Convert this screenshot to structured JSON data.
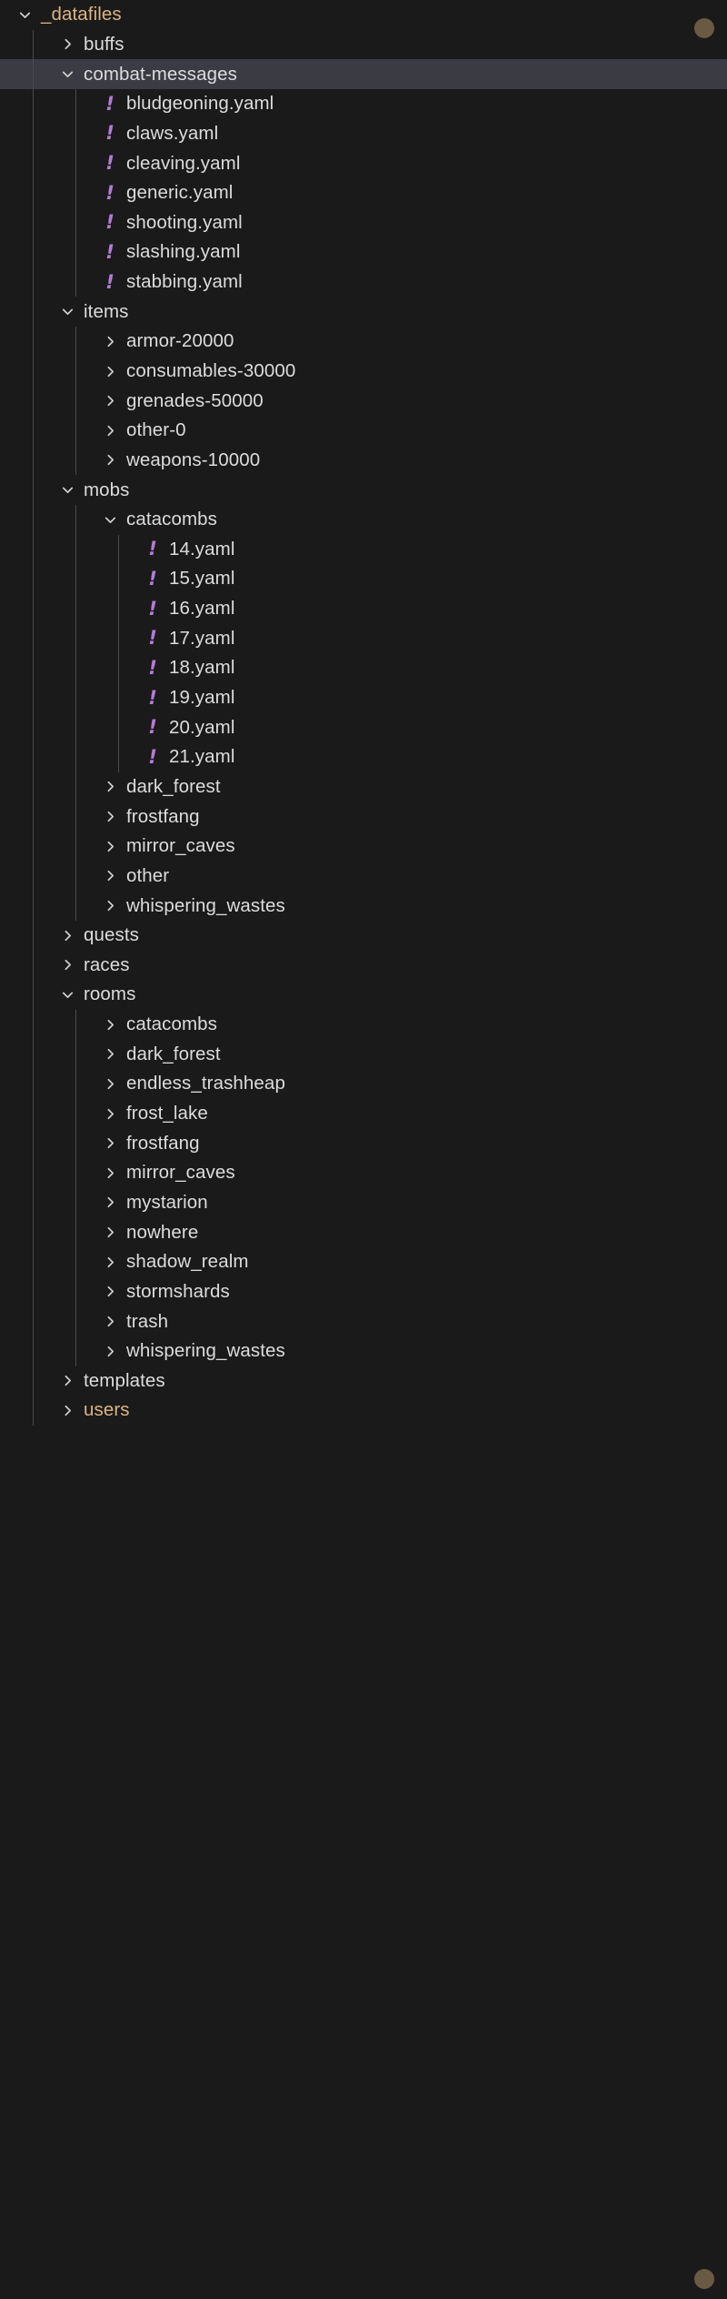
{
  "theme": {
    "background": "#1a1a1a",
    "selected_row_background": "#3b3b44",
    "text_color": "#dcdcdc",
    "accent_color": "#dbb382",
    "yaml_icon_color": "#b57bd8",
    "guide_color": "#4a4a4a",
    "dot_color": "#6b5a43"
  },
  "icons": {
    "chevron_right": "chevron-right-icon",
    "chevron_down": "chevron-down-icon",
    "yaml_file": "yaml-file-icon",
    "status_dot": "status-dot-icon"
  },
  "tree": {
    "root_label": "_datafiles",
    "nodes": [
      {
        "label": "_datafiles",
        "depth": 0,
        "type": "folder",
        "state": "expanded",
        "accent": true,
        "selected": false
      },
      {
        "label": "buffs",
        "depth": 1,
        "type": "folder",
        "state": "collapsed",
        "accent": false,
        "selected": false
      },
      {
        "label": "combat-messages",
        "depth": 1,
        "type": "folder",
        "state": "expanded",
        "accent": false,
        "selected": true
      },
      {
        "label": "bludgeoning.yaml",
        "depth": 2,
        "type": "file",
        "state": "none",
        "accent": false,
        "selected": false
      },
      {
        "label": "claws.yaml",
        "depth": 2,
        "type": "file",
        "state": "none",
        "accent": false,
        "selected": false
      },
      {
        "label": "cleaving.yaml",
        "depth": 2,
        "type": "file",
        "state": "none",
        "accent": false,
        "selected": false
      },
      {
        "label": "generic.yaml",
        "depth": 2,
        "type": "file",
        "state": "none",
        "accent": false,
        "selected": false
      },
      {
        "label": "shooting.yaml",
        "depth": 2,
        "type": "file",
        "state": "none",
        "accent": false,
        "selected": false
      },
      {
        "label": "slashing.yaml",
        "depth": 2,
        "type": "file",
        "state": "none",
        "accent": false,
        "selected": false
      },
      {
        "label": "stabbing.yaml",
        "depth": 2,
        "type": "file",
        "state": "none",
        "accent": false,
        "selected": false
      },
      {
        "label": "items",
        "depth": 1,
        "type": "folder",
        "state": "expanded",
        "accent": false,
        "selected": false
      },
      {
        "label": "armor-20000",
        "depth": 2,
        "type": "folder",
        "state": "collapsed",
        "accent": false,
        "selected": false
      },
      {
        "label": "consumables-30000",
        "depth": 2,
        "type": "folder",
        "state": "collapsed",
        "accent": false,
        "selected": false
      },
      {
        "label": "grenades-50000",
        "depth": 2,
        "type": "folder",
        "state": "collapsed",
        "accent": false,
        "selected": false
      },
      {
        "label": "other-0",
        "depth": 2,
        "type": "folder",
        "state": "collapsed",
        "accent": false,
        "selected": false
      },
      {
        "label": "weapons-10000",
        "depth": 2,
        "type": "folder",
        "state": "collapsed",
        "accent": false,
        "selected": false
      },
      {
        "label": "mobs",
        "depth": 1,
        "type": "folder",
        "state": "expanded",
        "accent": false,
        "selected": false
      },
      {
        "label": "catacombs",
        "depth": 2,
        "type": "folder",
        "state": "expanded",
        "accent": false,
        "selected": false
      },
      {
        "label": "14.yaml",
        "depth": 3,
        "type": "file",
        "state": "none",
        "accent": false,
        "selected": false
      },
      {
        "label": "15.yaml",
        "depth": 3,
        "type": "file",
        "state": "none",
        "accent": false,
        "selected": false
      },
      {
        "label": "16.yaml",
        "depth": 3,
        "type": "file",
        "state": "none",
        "accent": false,
        "selected": false
      },
      {
        "label": "17.yaml",
        "depth": 3,
        "type": "file",
        "state": "none",
        "accent": false,
        "selected": false
      },
      {
        "label": "18.yaml",
        "depth": 3,
        "type": "file",
        "state": "none",
        "accent": false,
        "selected": false
      },
      {
        "label": "19.yaml",
        "depth": 3,
        "type": "file",
        "state": "none",
        "accent": false,
        "selected": false
      },
      {
        "label": "20.yaml",
        "depth": 3,
        "type": "file",
        "state": "none",
        "accent": false,
        "selected": false
      },
      {
        "label": "21.yaml",
        "depth": 3,
        "type": "file",
        "state": "none",
        "accent": false,
        "selected": false
      },
      {
        "label": "dark_forest",
        "depth": 2,
        "type": "folder",
        "state": "collapsed",
        "accent": false,
        "selected": false
      },
      {
        "label": "frostfang",
        "depth": 2,
        "type": "folder",
        "state": "collapsed",
        "accent": false,
        "selected": false
      },
      {
        "label": "mirror_caves",
        "depth": 2,
        "type": "folder",
        "state": "collapsed",
        "accent": false,
        "selected": false
      },
      {
        "label": "other",
        "depth": 2,
        "type": "folder",
        "state": "collapsed",
        "accent": false,
        "selected": false
      },
      {
        "label": "whispering_wastes",
        "depth": 2,
        "type": "folder",
        "state": "collapsed",
        "accent": false,
        "selected": false
      },
      {
        "label": "quests",
        "depth": 1,
        "type": "folder",
        "state": "collapsed",
        "accent": false,
        "selected": false
      },
      {
        "label": "races",
        "depth": 1,
        "type": "folder",
        "state": "collapsed",
        "accent": false,
        "selected": false
      },
      {
        "label": "rooms",
        "depth": 1,
        "type": "folder",
        "state": "expanded",
        "accent": false,
        "selected": false
      },
      {
        "label": "catacombs",
        "depth": 2,
        "type": "folder",
        "state": "collapsed",
        "accent": false,
        "selected": false
      },
      {
        "label": "dark_forest",
        "depth": 2,
        "type": "folder",
        "state": "collapsed",
        "accent": false,
        "selected": false
      },
      {
        "label": "endless_trashheap",
        "depth": 2,
        "type": "folder",
        "state": "collapsed",
        "accent": false,
        "selected": false
      },
      {
        "label": "frost_lake",
        "depth": 2,
        "type": "folder",
        "state": "collapsed",
        "accent": false,
        "selected": false
      },
      {
        "label": "frostfang",
        "depth": 2,
        "type": "folder",
        "state": "collapsed",
        "accent": false,
        "selected": false
      },
      {
        "label": "mirror_caves",
        "depth": 2,
        "type": "folder",
        "state": "collapsed",
        "accent": false,
        "selected": false
      },
      {
        "label": "mystarion",
        "depth": 2,
        "type": "folder",
        "state": "collapsed",
        "accent": false,
        "selected": false
      },
      {
        "label": "nowhere",
        "depth": 2,
        "type": "folder",
        "state": "collapsed",
        "accent": false,
        "selected": false
      },
      {
        "label": "shadow_realm",
        "depth": 2,
        "type": "folder",
        "state": "collapsed",
        "accent": false,
        "selected": false
      },
      {
        "label": "stormshards",
        "depth": 2,
        "type": "folder",
        "state": "collapsed",
        "accent": false,
        "selected": false
      },
      {
        "label": "trash",
        "depth": 2,
        "type": "folder",
        "state": "collapsed",
        "accent": false,
        "selected": false
      },
      {
        "label": "whispering_wastes",
        "depth": 2,
        "type": "folder",
        "state": "collapsed",
        "accent": false,
        "selected": false
      },
      {
        "label": "templates",
        "depth": 1,
        "type": "folder",
        "state": "collapsed",
        "accent": false,
        "selected": false
      },
      {
        "label": "users",
        "depth": 1,
        "type": "folder",
        "state": "collapsed",
        "accent": true,
        "selected": false
      }
    ]
  }
}
